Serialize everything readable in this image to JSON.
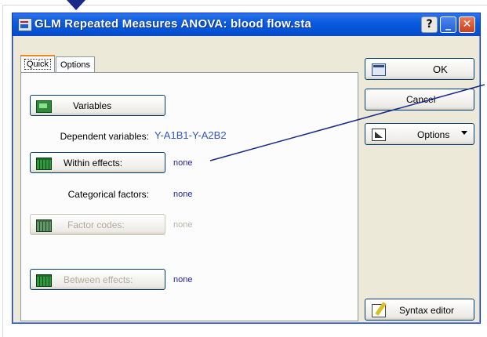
{
  "window": {
    "title": "GLM Repeated Measures ANOVA: blood flow.sta",
    "help_label": "?",
    "minimize_label": "_",
    "close_label": "✕"
  },
  "tabs": [
    {
      "label": "Quick",
      "active": true
    },
    {
      "label": "Options",
      "active": false
    }
  ],
  "quick": {
    "variables_button": "Variables",
    "dependent_label": "Dependent variables:",
    "dependent_value": "Y-A1B1-Y-A2B2",
    "within_button": "Within effects:",
    "within_value": "none",
    "categorical_label": "Categorical factors:",
    "categorical_value": "none",
    "factor_codes_button": "Factor codes:",
    "factor_codes_value": "none",
    "between_button": "Between effects:",
    "between_value": "none"
  },
  "side": {
    "ok_label": "OK",
    "cancel_label": "Cancel",
    "options_label": "Options",
    "syntax_label": "Syntax editor"
  },
  "colors": {
    "title_bar": "#0a5ce0",
    "value_text": "#2222aa",
    "dialog_bg": "#ece9d8",
    "annotation": "#1a2a8a"
  }
}
